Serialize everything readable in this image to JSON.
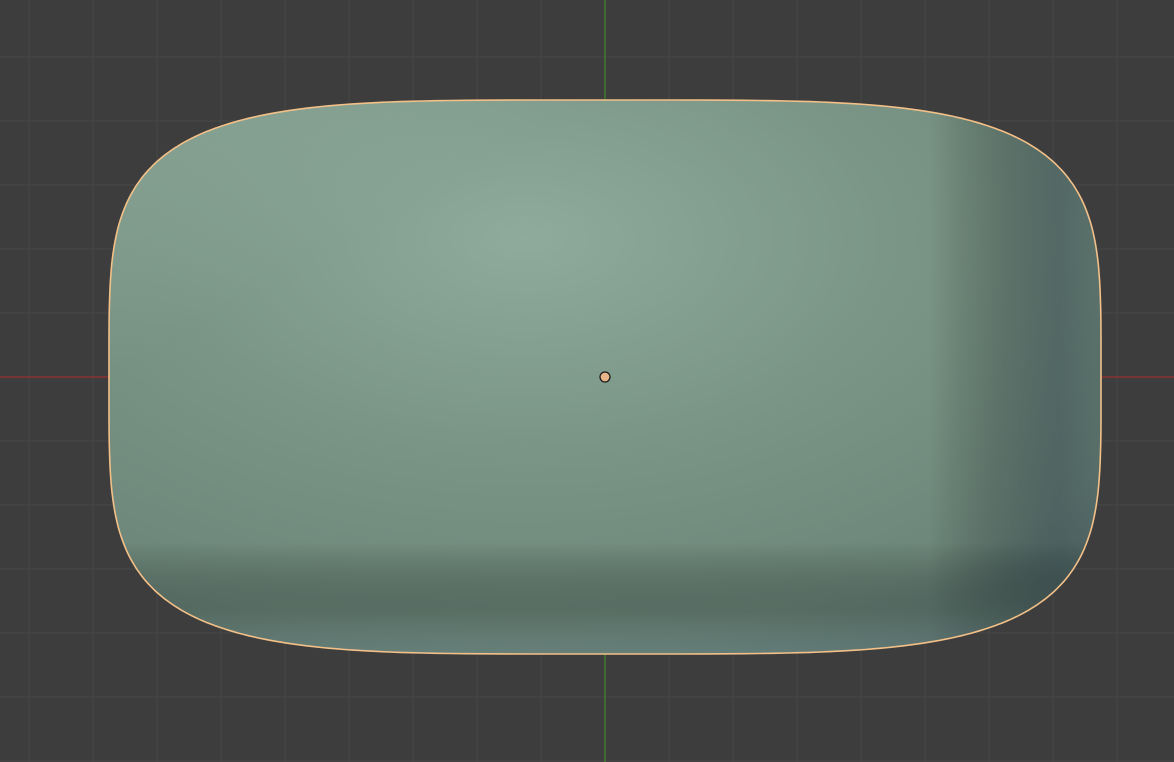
{
  "viewport": {
    "view": "top-orthographic",
    "background_color": "#3d3d3d",
    "grid_minor_color": "#484848",
    "grid_major_color": "#4a4a4a",
    "x_axis_color": "#9a2f2f",
    "y_axis_color": "#3f8a2f",
    "grid_visible": true
  },
  "object": {
    "shape": "rounded-box",
    "selected": true,
    "shading": "solid",
    "base_color": "#7a9585",
    "highlight_color": "#8fb0a0",
    "shadow_color": "#4f6358",
    "outline_color": "#f3c088",
    "origin_color": "#e8b48a",
    "origin_outline_color": "#1a1a1a"
  }
}
